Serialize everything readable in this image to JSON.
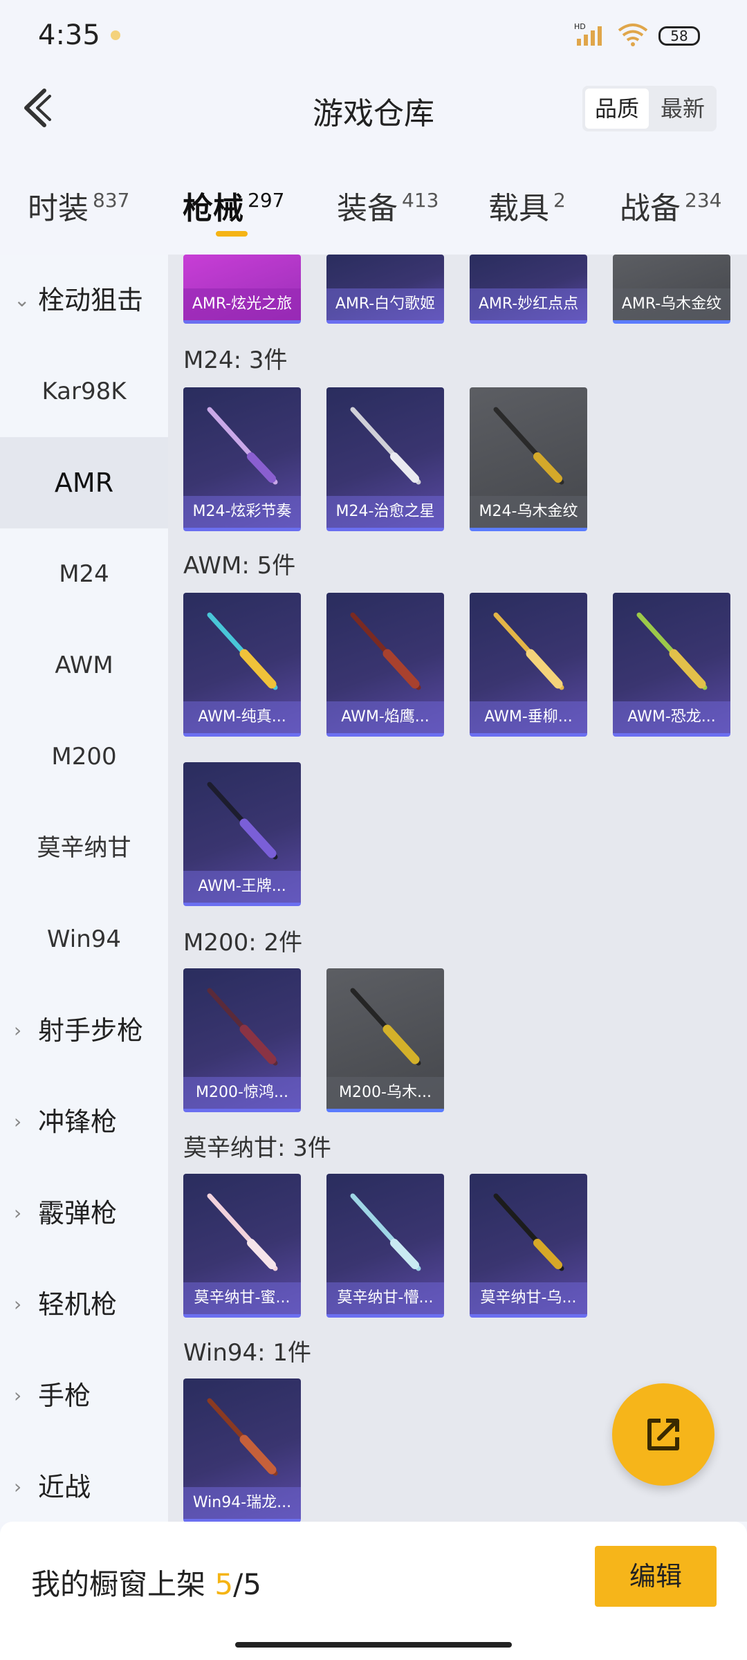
{
  "status_bar": {
    "time": "4:35",
    "battery": "58",
    "network_label": "HD"
  },
  "header": {
    "title": "游戏仓库",
    "sort_quality": "品质",
    "sort_newest": "最新"
  },
  "tabs": [
    {
      "label": "时装",
      "count": "837"
    },
    {
      "label": "枪械",
      "count": "297"
    },
    {
      "label": "装备",
      "count": "413"
    },
    {
      "label": "载具",
      "count": "2"
    },
    {
      "label": "战备",
      "count": "234"
    }
  ],
  "sidebar": {
    "items": [
      {
        "label": "栓动狙击"
      },
      {
        "label": "Kar98K"
      },
      {
        "label": "AMR"
      },
      {
        "label": "M24"
      },
      {
        "label": "AWM"
      },
      {
        "label": "M200"
      },
      {
        "label": "莫辛纳甘"
      },
      {
        "label": "Win94"
      },
      {
        "label": "射手步枪"
      },
      {
        "label": "冲锋枪"
      },
      {
        "label": "霰弹枪"
      },
      {
        "label": "轻机枪"
      },
      {
        "label": "手枪"
      },
      {
        "label": "近战"
      }
    ]
  },
  "content": {
    "amr_partial": [
      "AMR-炫光之旅",
      "AMR-白勺歌姬",
      "AMR-妙红点点",
      "AMR-乌木金纹"
    ],
    "sections": [
      {
        "title": "M24: 3件",
        "items": [
          "M24-炫彩节奏",
          "M24-治愈之星",
          "M24-乌木金纹"
        ]
      },
      {
        "title": "AWM: 5件",
        "items": [
          "AWM-纯真...",
          "AWM-焰鹰...",
          "AWM-垂柳...",
          "AWM-恐龙...",
          "AWM-王牌..."
        ]
      },
      {
        "title": "M200: 2件",
        "items": [
          "M200-惊鸿...",
          "M200-乌木..."
        ]
      },
      {
        "title": "莫辛纳甘: 3件",
        "items": [
          "莫辛纳甘-蜜...",
          "莫辛纳甘-懵...",
          "莫辛纳甘-乌..."
        ]
      },
      {
        "title": "Win94: 1件",
        "items": [
          "Win94-瑞龙..."
        ]
      }
    ]
  },
  "bottom": {
    "shelf_label": "我的橱窗上架 ",
    "shelf_used": "5",
    "shelf_total": "/5",
    "edit_label": "编辑"
  },
  "colors": {
    "accent": "#f6b51a",
    "card_purple": "#3a3570",
    "card_grey": "#5c5e63"
  }
}
